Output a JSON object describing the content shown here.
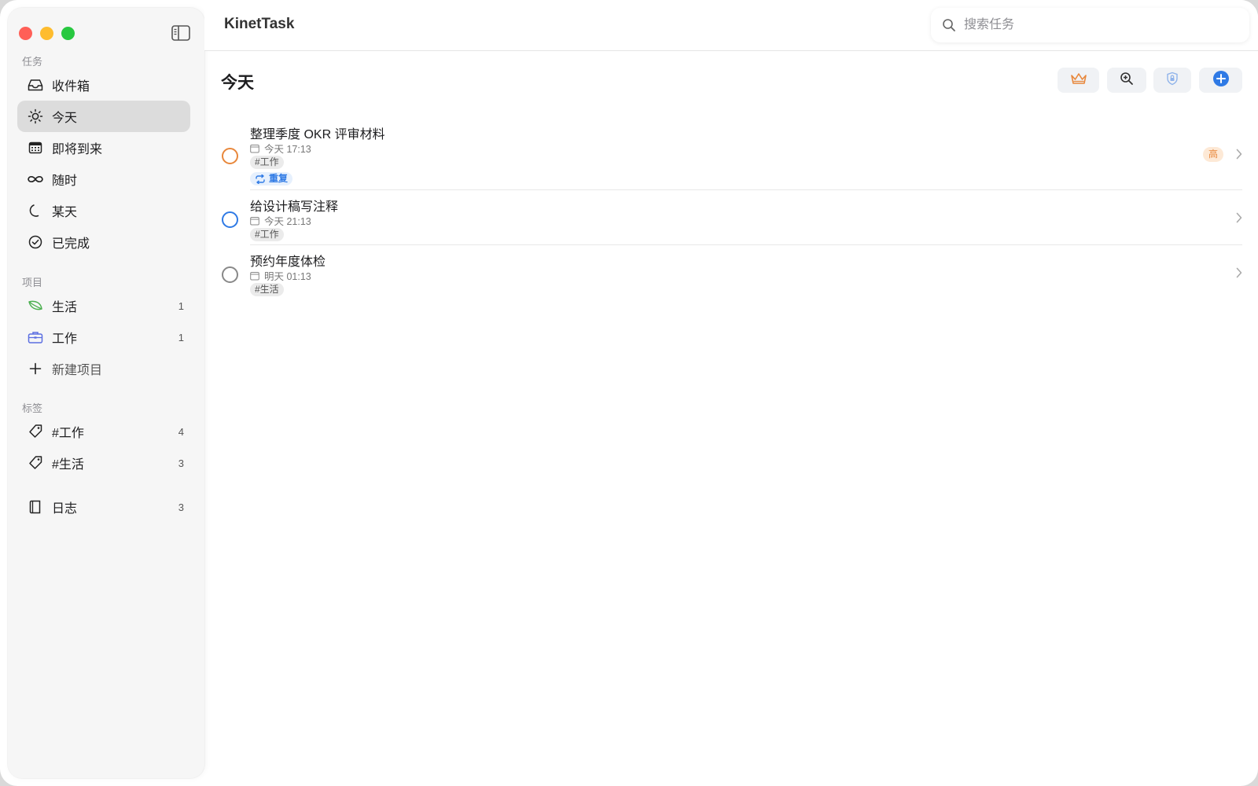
{
  "app": {
    "title": "KinetTask"
  },
  "search": {
    "placeholder": "搜索任务"
  },
  "sidebar": {
    "tasks_header": "任务",
    "tasks": [
      {
        "label": "收件箱",
        "icon": "inbox-icon"
      },
      {
        "label": "今天",
        "icon": "sun-icon",
        "active": true
      },
      {
        "label": "即将到来",
        "icon": "calendar-icon"
      },
      {
        "label": "随时",
        "icon": "infinity-icon"
      },
      {
        "label": "某天",
        "icon": "moon-icon"
      },
      {
        "label": "已完成",
        "icon": "check-circle-icon"
      }
    ],
    "projects_header": "项目",
    "projects": [
      {
        "label": "生活",
        "count": "1",
        "icon": "leaf-icon",
        "color": "#4caf50"
      },
      {
        "label": "工作",
        "count": "1",
        "icon": "briefcase-icon",
        "color": "#5b6ee1"
      }
    ],
    "new_project_label": "新建项目",
    "tags_header": "标签",
    "tags": [
      {
        "label": "#工作",
        "count": "4"
      },
      {
        "label": "#生活",
        "count": "3"
      }
    ],
    "journal": {
      "label": "日志",
      "count": "3"
    }
  },
  "main": {
    "title": "今天",
    "tasks": [
      {
        "title": "整理季度 OKR 评审材料",
        "due": "今天 17:13",
        "tag": "#工作",
        "repeat": "重复",
        "priority": "高",
        "circle_color": "#e8873b"
      },
      {
        "title": "给设计稿写注释",
        "due": "今天 21:13",
        "tag": "#工作",
        "circle_color": "#2f7ae5"
      },
      {
        "title": "预约年度体检",
        "due": "明天 01:13",
        "tag": "#生活",
        "circle_color": "#888888"
      }
    ]
  },
  "colors": {
    "accent": "#2f7ae5",
    "priority_high": "#e8873b"
  }
}
